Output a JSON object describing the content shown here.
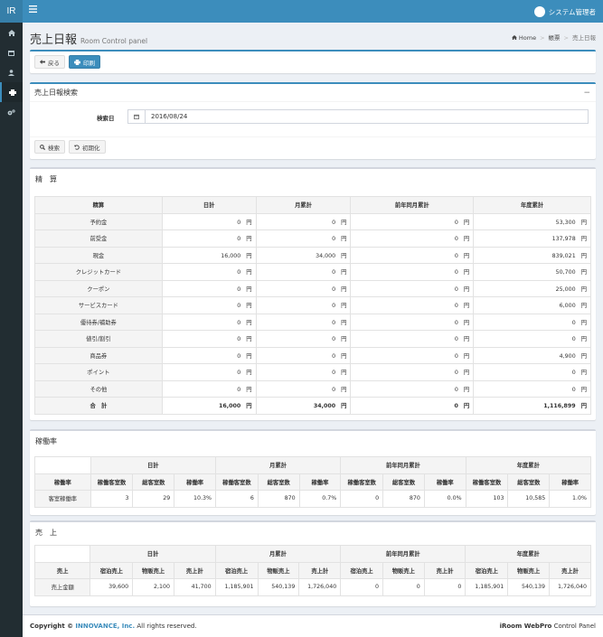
{
  "app": {
    "logo": "IR",
    "user_name": "システム管理者"
  },
  "page": {
    "title": "売上日報",
    "subtitle": "Room Control panel"
  },
  "breadcrumb": {
    "home": "Home",
    "section": "帳票",
    "current": "売上日報"
  },
  "toolbar": {
    "back_label": "戻る",
    "print_label": "印刷"
  },
  "search": {
    "title": "売上日報検索",
    "collapse": "−",
    "date_label": "検索日",
    "date_value": "2016/08/24",
    "search_label": "検索",
    "reset_label": "初期化"
  },
  "seisan": {
    "title": "精　算",
    "headers": [
      "精算",
      "日計",
      "月累計",
      "前年同月累計",
      "年度累計"
    ],
    "unit": "円",
    "rows": [
      {
        "label": "予約金",
        "values": [
          "0",
          "0",
          "0",
          "53,300"
        ]
      },
      {
        "label": "前受金",
        "values": [
          "0",
          "0",
          "0",
          "137,978"
        ]
      },
      {
        "label": "現金",
        "values": [
          "16,000",
          "34,000",
          "0",
          "839,021"
        ]
      },
      {
        "label": "クレジットカード",
        "values": [
          "0",
          "0",
          "0",
          "50,700"
        ]
      },
      {
        "label": "クーポン",
        "values": [
          "0",
          "0",
          "0",
          "25,000"
        ]
      },
      {
        "label": "サービスカード",
        "values": [
          "0",
          "0",
          "0",
          "6,000"
        ]
      },
      {
        "label": "優待券/補助券",
        "values": [
          "0",
          "0",
          "0",
          "0"
        ]
      },
      {
        "label": "値引/割引",
        "values": [
          "0",
          "0",
          "0",
          "0"
        ]
      },
      {
        "label": "商品券",
        "values": [
          "0",
          "0",
          "0",
          "4,900"
        ]
      },
      {
        "label": "ポイント",
        "values": [
          "0",
          "0",
          "0",
          "0"
        ]
      },
      {
        "label": "その他",
        "values": [
          "0",
          "0",
          "0",
          "0"
        ]
      }
    ],
    "total": {
      "label": "合　計",
      "values": [
        "16,000",
        "34,000",
        "0",
        "1,116,899"
      ]
    }
  },
  "kadou": {
    "title": "稼働率",
    "groups": [
      "日計",
      "月累計",
      "前年同月累計",
      "年度累計"
    ],
    "row_header": "稼働率",
    "sub_headers": [
      "稼働客室数",
      "総客室数",
      "稼働率"
    ],
    "row": {
      "label": "客室稼働率",
      "values": [
        "3",
        "29",
        "10.3%",
        "6",
        "870",
        "0.7%",
        "0",
        "870",
        "0.0%",
        "103",
        "10,585",
        "1.0%"
      ]
    }
  },
  "uriage": {
    "title": "売　上",
    "groups": [
      "日計",
      "月累計",
      "前年同月累計",
      "年度累計"
    ],
    "row_header": "売上",
    "sub_headers": [
      "宿泊売上",
      "物販売上",
      "売上計"
    ],
    "row": {
      "label": "売上金額",
      "values": [
        "39,600",
        "2,100",
        "41,700",
        "1,185,901",
        "540,139",
        "1,726,040",
        "0",
        "0",
        "0",
        "1,185,901",
        "540,139",
        "1,726,040"
      ]
    }
  },
  "footer": {
    "copyright_prefix": "Copyright ©",
    "company": "INNOVANCE, Inc.",
    "rights": "All rights reserved.",
    "product_bold": "iRoom WebPro",
    "product_rest": "Control Panel"
  }
}
